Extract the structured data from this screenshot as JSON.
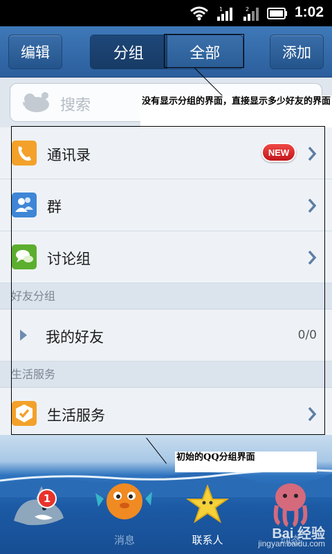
{
  "status_bar": {
    "time": "1:02"
  },
  "header": {
    "edit_label": "编辑",
    "seg_group_label": "分组",
    "seg_all_label": "全部",
    "add_label": "添加"
  },
  "search": {
    "placeholder": "搜索"
  },
  "annotations": {
    "top": "没有显示分组的界面，直接显示多少好友的界面",
    "bottom": "初始的QQ分组界面"
  },
  "list": {
    "contacts_label": "通讯录",
    "new_badge": "NEW",
    "groups_label": "群",
    "discussion_label": "讨论组"
  },
  "friend_section": {
    "header": "好友分组",
    "my_friends_label": "我的好友",
    "my_friends_count": "0/0"
  },
  "life_section": {
    "header": "生活服务",
    "item_label": "生活服务"
  },
  "tabs": [
    {
      "label": "消息",
      "badge": "1"
    },
    {
      "label": "联系人"
    },
    {
      "label": "动态"
    },
    {
      "label": ""
    }
  ],
  "watermark": {
    "main": "Bai 经验",
    "sub": "jingyan.baidu.com"
  }
}
